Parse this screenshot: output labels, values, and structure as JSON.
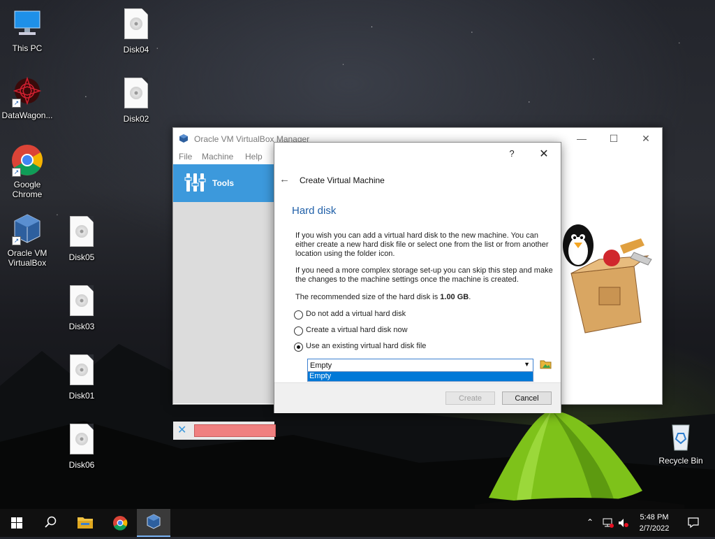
{
  "desktop": {
    "icons": {
      "this_pc": "This PC",
      "datawagon": "DataWagon...",
      "chrome": "Google Chrome",
      "virtualbox": "Oracle VM VirtualBox",
      "disk04": "Disk04",
      "disk02": "Disk02",
      "disk05": "Disk05",
      "disk03": "Disk03",
      "disk01": "Disk01",
      "disk06": "Disk06",
      "recycle_bin": "Recycle Bin"
    }
  },
  "manager": {
    "title": "Oracle VM VirtualBox Manager",
    "menu": {
      "file": "File",
      "machine": "Machine",
      "help": "Help"
    },
    "window_buttons": {
      "minimize": "—",
      "maximize": "☐",
      "close": "✕"
    },
    "sidebar": {
      "tools_label": "Tools"
    }
  },
  "dialog": {
    "help": "?",
    "close": "✕",
    "back": "←",
    "heading": "Create Virtual Machine",
    "section_title": "Hard disk",
    "para1": "If you wish you can add a virtual hard disk to the new machine. You can either create a new hard disk file or select one from the list or from another location using the folder icon.",
    "para2": "If you need a more complex storage set-up you can skip this step and make the changes to the machine settings once the machine is created.",
    "recommended_prefix": "The recommended size of the hard disk is ",
    "recommended_size": "1.00 GB",
    "recommended_suffix": ".",
    "options": {
      "none": "Do not add a virtual hard disk",
      "create": "Create a virtual hard disk now",
      "existing": "Use an existing virtual hard disk file"
    },
    "selected_option": "existing",
    "combo_value": "Empty",
    "combo_options": [
      "Empty"
    ],
    "buttons": {
      "create": "Create",
      "cancel": "Cancel"
    }
  },
  "taskbar": {
    "time": "5:48 PM",
    "date": "2/7/2022"
  },
  "colors": {
    "accent": "#3c99dc",
    "selection": "#0078d7",
    "section_title": "#1f5fa8"
  }
}
